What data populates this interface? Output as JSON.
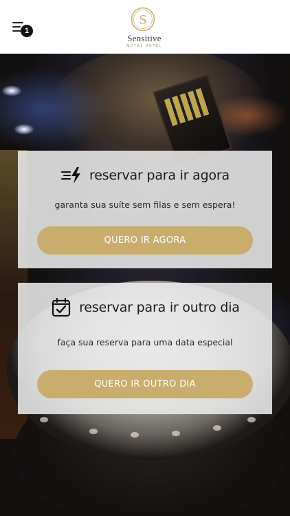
{
  "header": {
    "menu_badge_count": "1",
    "logo": {
      "brand": "Sensitive",
      "tagline": "MOTEL HOTEL",
      "gold_color": "#c9ad6d"
    }
  },
  "cards": [
    {
      "icon": "lightning-fast-icon",
      "title": "reservar para ir agora",
      "subtitle": "garanta sua suíte sem filas e sem espera!",
      "button_label": "QUERO IR AGORA"
    },
    {
      "icon": "calendar-check-icon",
      "title": "reservar para ir outro dia",
      "subtitle": "faça sua reserva para uma data especial",
      "button_label": "QUERO IR OUTRO DIA"
    }
  ],
  "colors": {
    "accent": "#c9ad6d",
    "card_bg": "#ebebeb",
    "header_bg": "#ffffff"
  }
}
